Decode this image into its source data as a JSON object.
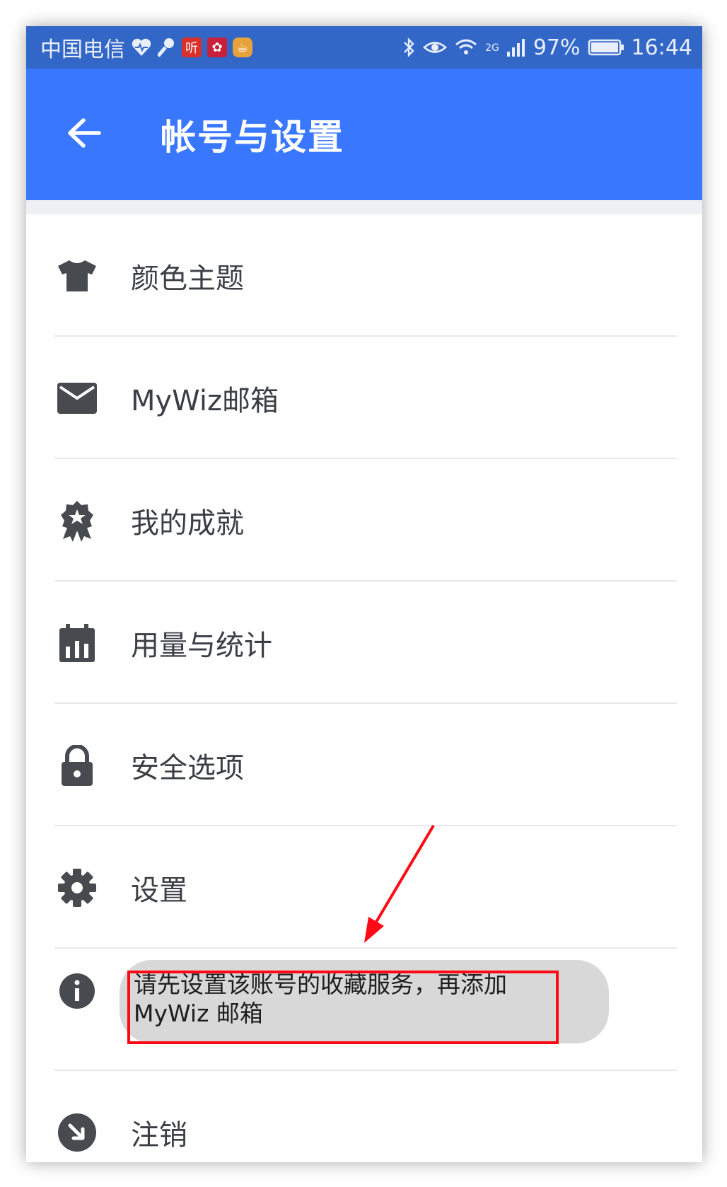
{
  "status_bar": {
    "carrier": "中国电信",
    "app_icon_box_1": "听",
    "battery_percent": "97%",
    "network": "2G",
    "time": "16:44"
  },
  "app_bar": {
    "title": "帐号与设置",
    "back_icon": "arrow-left-icon"
  },
  "menu": {
    "items": [
      {
        "label": "颜色主题",
        "icon": "tshirt-icon"
      },
      {
        "label": "MyWiz邮箱",
        "icon": "mail-icon"
      },
      {
        "label": "我的成就",
        "icon": "badge-icon"
      },
      {
        "label": "用量与统计",
        "icon": "stats-calendar-icon"
      },
      {
        "label": "安全选项",
        "icon": "lock-icon"
      },
      {
        "label": "设置",
        "icon": "gear-icon"
      },
      {
        "label": "",
        "icon": "info-icon"
      },
      {
        "label": "注销",
        "icon": "logout-icon"
      }
    ]
  },
  "toast": {
    "message_line_1": "请先设置该账号的收藏服务，再添加",
    "message_line_2": "MyWiz 邮箱"
  },
  "colors": {
    "status_bar": "#3267c8",
    "app_bar": "#3a77ff",
    "highlight": "#ff0a14",
    "icon": "#474b50"
  }
}
